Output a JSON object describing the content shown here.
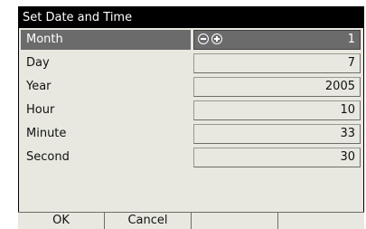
{
  "window": {
    "title": "Set Date and Time"
  },
  "fields": [
    {
      "label": "Month",
      "value": "1",
      "selected": true
    },
    {
      "label": "Day",
      "value": "7"
    },
    {
      "label": "Year",
      "value": "2005"
    },
    {
      "label": "Hour",
      "value": "10"
    },
    {
      "label": "Minute",
      "value": "33"
    },
    {
      "label": "Second",
      "value": "30"
    }
  ],
  "spinner": {
    "decrement_icon": "minus-circle-icon",
    "increment_icon": "plus-circle-icon"
  },
  "softkeys": [
    {
      "label": "OK"
    },
    {
      "label": "Cancel"
    },
    {
      "label": ""
    },
    {
      "label": ""
    }
  ],
  "colors": {
    "background": "#e8e8e0",
    "titlebar": "#000000",
    "selected": "#6b6b6b"
  }
}
